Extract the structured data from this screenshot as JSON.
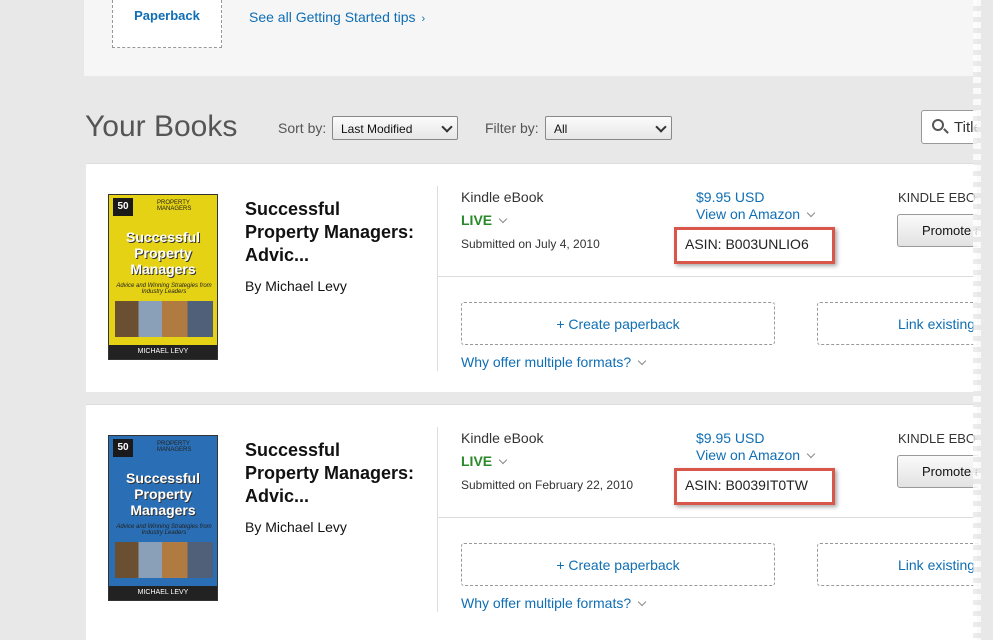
{
  "top": {
    "paperback_label": "Paperback",
    "tips_link": "See all Getting Started tips",
    "tips_chevron": "›"
  },
  "header": {
    "title": "Your Books",
    "sort_label": "Sort by:",
    "sort_value": "Last Modified",
    "filter_label": "Filter by:",
    "filter_value": "All",
    "search_placeholder": "Title"
  },
  "books": [
    {
      "title": "Successful Property Managers: Advic...",
      "author": "By Michael Levy",
      "cover": {
        "badge": "50",
        "topline": "PROPERTY MANAGERS",
        "title": "Successful Property Managers",
        "subtitle": "Advice and Winning Strategies from Industry Leaders",
        "author": "MICHAEL LEVY",
        "color": "#e5d214"
      },
      "format": "Kindle eBook",
      "status": "LIVE",
      "submitted": "Submitted on July 4, 2010",
      "price": "$9.95 USD",
      "view_link": "View on Amazon",
      "asin": "ASIN: B003UNLIO6",
      "kindle_label": "KINDLE EBOOK",
      "promote": "Promote and",
      "create_paperback": "+ Create paperback",
      "link_existing": "Link existing p",
      "why": "Why offer multiple formats?"
    },
    {
      "title": "Successful Property Managers: Advic...",
      "author": "By Michael Levy",
      "cover": {
        "badge": "50",
        "topline": "PROPERTY MANAGERS",
        "title": "Successful Property Managers",
        "subtitle": "Advice and Winning Strategies from Industry Leaders",
        "author": "MICHAEL LEVY",
        "color": "#2a6fb5"
      },
      "format": "Kindle eBook",
      "status": "LIVE",
      "submitted": "Submitted on February 22, 2010",
      "price": "$9.95 USD",
      "view_link": "View on Amazon",
      "asin": "ASIN: B0039IT0TW",
      "kindle_label": "KINDLE EBOOK",
      "promote": "Promote and",
      "create_paperback": "+ Create paperback",
      "link_existing": "Link existing p",
      "why": "Why offer multiple formats?"
    }
  ],
  "colors": {
    "link": "#0f6eb4",
    "live": "#2a8a2a",
    "highlight": "#d9564a"
  }
}
